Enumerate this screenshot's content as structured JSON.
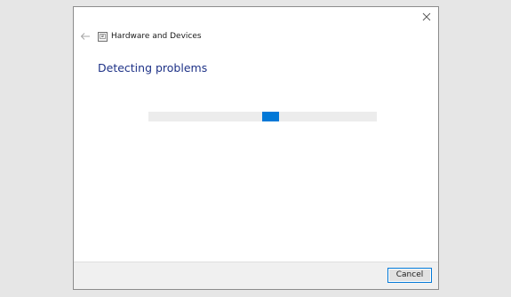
{
  "window": {
    "title": "Hardware and Devices",
    "close_icon": "close-icon",
    "back_icon": "back-arrow-icon",
    "app_icon": "troubleshooter-icon"
  },
  "main": {
    "heading": "Detecting problems",
    "progress": {
      "state": "indeterminate",
      "indicator_color": "#0078d7",
      "track_color": "#ececec"
    }
  },
  "footer": {
    "cancel_label": "Cancel"
  },
  "colors": {
    "heading": "#1e3287",
    "accent": "#0078d7",
    "footer_bg": "#f0f0f0"
  }
}
